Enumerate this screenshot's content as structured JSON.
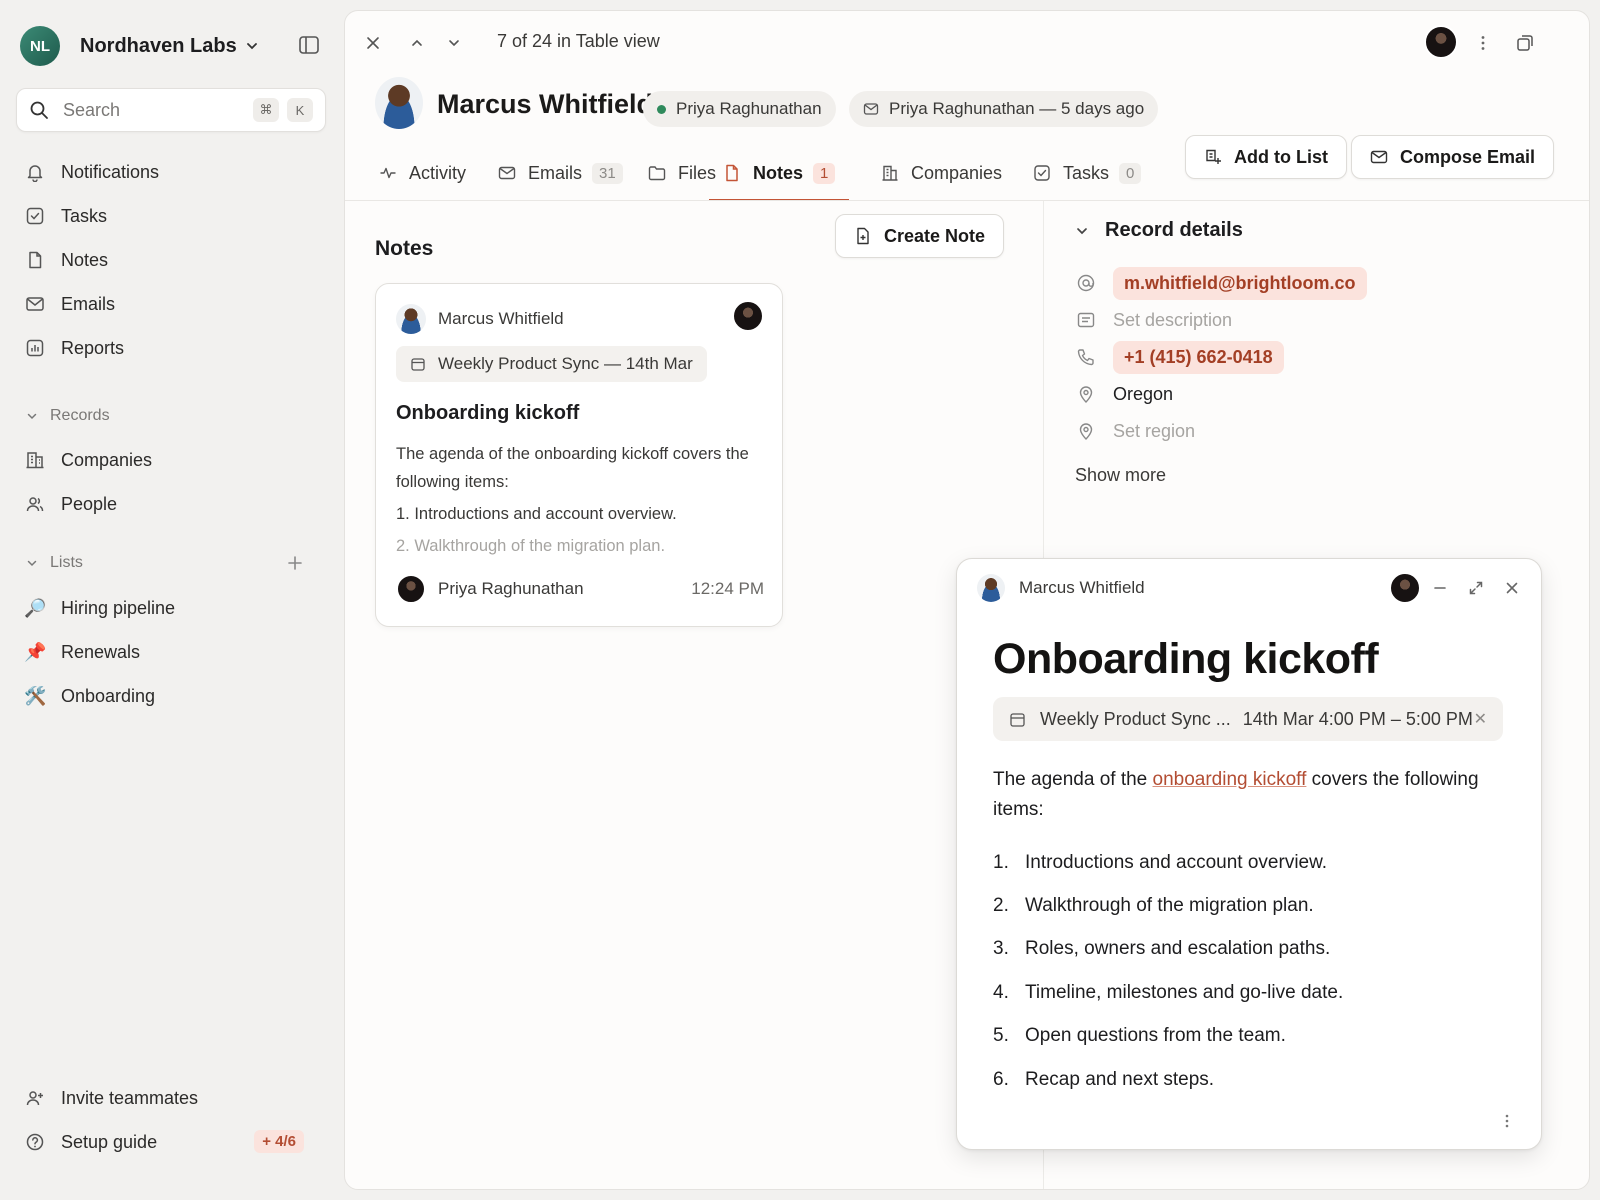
{
  "workspace": {
    "initials": "NL",
    "name": "Nordhaven Labs"
  },
  "search": {
    "label": "Search",
    "key1": "⌘",
    "key2": "K"
  },
  "nav": [
    {
      "label": "Notifications",
      "icon": "bell-icon"
    },
    {
      "label": "Tasks",
      "icon": "check-square-icon"
    },
    {
      "label": "Notes",
      "icon": "document-icon"
    },
    {
      "label": "Emails",
      "icon": "mail-icon"
    },
    {
      "label": "Reports",
      "icon": "bar-chart-icon"
    }
  ],
  "records": {
    "heading": "Records",
    "items": [
      {
        "label": "Companies",
        "icon": "building-icon"
      },
      {
        "label": "People",
        "icon": "people-icon"
      }
    ]
  },
  "lists": {
    "heading": "Lists",
    "items": [
      {
        "label": "Hiring pipeline",
        "emoji": "🔎"
      },
      {
        "label": "Renewals",
        "emoji": "📌"
      },
      {
        "label": "Onboarding",
        "emoji": "🛠️"
      }
    ]
  },
  "bottom": {
    "invite": "Invite teammates",
    "setup": "Setup guide",
    "setup_badge": "+ 4/6"
  },
  "topbar": {
    "breadcrumb": "7 of 24 in Table view"
  },
  "record": {
    "name": "Marcus Whitfield",
    "owner": "Priya Raghunathan",
    "last_contact": "Priya Raghunathan — 5 days ago"
  },
  "tabs": [
    {
      "label": "Activity",
      "count": null
    },
    {
      "label": "Emails",
      "count": "31"
    },
    {
      "label": "Files",
      "count": null
    },
    {
      "label": "Notes",
      "count": "1"
    },
    {
      "label": "Companies",
      "count": null
    },
    {
      "label": "Tasks",
      "count": "0"
    }
  ],
  "actions": {
    "add_to_list": "Add to List",
    "compose_email": "Compose Email"
  },
  "notes": {
    "title": "Notes",
    "create": "Create Note",
    "card": {
      "author": "Marcus Whitfield",
      "meeting": "Weekly Product Sync — 14th Mar",
      "title": "Onboarding kickoff",
      "body": "The agenda of the onboarding kickoff covers the following items:",
      "line1": "1. Introductions and account overview.",
      "line2": "2. Walkthrough of the migration plan.",
      "footer_author": "Priya Raghunathan",
      "time": "12:24 PM"
    }
  },
  "record_details": {
    "heading": "Record details",
    "email": "m.whitfield@brightloom.co",
    "description_placeholder": "Set description",
    "phone": "+1 (415) 662-0418",
    "location": "Oregon",
    "region_placeholder": "Set region",
    "show_more": "Show more"
  },
  "note_panel": {
    "author": "Marcus Whitfield",
    "title": "Onboarding kickoff",
    "meeting_name": "Weekly Product Sync ...",
    "meeting_time": "14th Mar 4:00 PM – 5:00 PM",
    "body_before": "The agenda of the ",
    "body_link": "onboarding kickoff",
    "body_after": " covers the following items:",
    "items": [
      {
        "num": "1.",
        "text": "Introductions and account overview."
      },
      {
        "num": "2.",
        "text": "Walkthrough of the migration plan."
      },
      {
        "num": "3.",
        "text": "Roles, owners and escalation paths."
      },
      {
        "num": "4.",
        "text": "Timeline, milestones and go-live date."
      },
      {
        "num": "5.",
        "text": "Open questions from the team."
      },
      {
        "num": "6.",
        "text": "Recap and next steps."
      }
    ]
  },
  "colors": {
    "accent": "#c35436",
    "pill_bg": "#fbe3dd",
    "status_green": "#2f8a5c"
  }
}
